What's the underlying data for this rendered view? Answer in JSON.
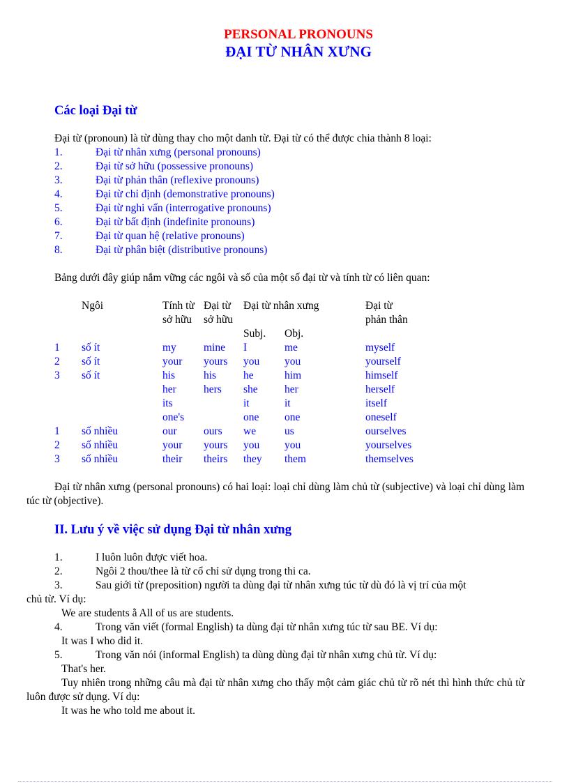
{
  "header": {
    "title_en": "PERSONAL PRONOUNS",
    "title_vn": "ĐẠI TỪ NHÂN XƯNG"
  },
  "section1": {
    "heading": "Các loại Đại từ",
    "intro": "Đại từ (pronoun) là từ dùng thay cho một danh từ. Đại từ có thể được chia thành 8 loại:",
    "types": [
      {
        "num": "1.",
        "label": "Đại từ nhân xưng (personal pronouns)"
      },
      {
        "num": "2.",
        "label": "Đại từ sở hữu (possessive pronouns)"
      },
      {
        "num": "3.",
        "label": "Đại từ phản thân (reflexive pronouns)"
      },
      {
        "num": "4.",
        "label": "Đại từ chỉ định (demonstrative pronouns)"
      },
      {
        "num": "5.",
        "label": "Đại từ nghi vấn (interrogative pronouns)"
      },
      {
        "num": "6.",
        "label": "Đại từ bất định (indefinite pronouns)"
      },
      {
        "num": "7.",
        "label": "Đại từ quan hệ (relative pronouns)"
      },
      {
        "num": "8.",
        "label": "Đại từ phân biệt (distributive pronouns)"
      }
    ],
    "table_intro": "Bảng dưới đây giúp nắm vững các ngôi và số của một số đại từ và tính từ có liên quan:",
    "table": {
      "headers": {
        "person": "Ngôi",
        "poss_adj_1": "Tính từ",
        "poss_adj_2": "sở hữu",
        "poss_pron_1": "Đại từ",
        "poss_pron_2": "sở hữu",
        "personal": "Đại từ nhân xưng",
        "subj": "Subj.",
        "obj": "Obj.",
        "reflexive_1": "Đại từ",
        "reflexive_2": "phản thân"
      },
      "rows": [
        {
          "person": "1",
          "number": "số ít",
          "poss_adj": "my",
          "poss_pron": "mine",
          "subj": "I",
          "obj": "me",
          "reflexive": "myself"
        },
        {
          "person": "2",
          "number": "số ít",
          "poss_adj": "your",
          "poss_pron": "yours",
          "subj": "you",
          "obj": "you",
          "reflexive": "yourself"
        },
        {
          "person": "3",
          "number": "số ít",
          "poss_adj": "his",
          "poss_pron": "his",
          "subj": "he",
          "obj": "him",
          "reflexive": "himself"
        },
        {
          "person": "",
          "number": "",
          "poss_adj": "her",
          "poss_pron": "hers",
          "subj": "she",
          "obj": "her",
          "reflexive": "herself"
        },
        {
          "person": "",
          "number": "",
          "poss_adj": "its",
          "poss_pron": "",
          "subj": "it",
          "obj": "it",
          "reflexive": "itself"
        },
        {
          "person": "",
          "number": "",
          "poss_adj": "one's",
          "poss_pron": "",
          "subj": "one",
          "obj": "one",
          "reflexive": "oneself"
        },
        {
          "person": "1",
          "number": "số nhiều",
          "poss_adj": "our",
          "poss_pron": "ours",
          "subj": "we",
          "obj": "us",
          "reflexive": "ourselves"
        },
        {
          "person": "2",
          "number": "số nhiều",
          "poss_adj": "your",
          "poss_pron": "yours",
          "subj": "you",
          "obj": "you",
          "reflexive": "yourselves"
        },
        {
          "person": "3",
          "number": "số nhiều",
          "poss_adj": "their",
          "poss_pron": "theirs",
          "subj": "they",
          "obj": "them",
          "reflexive": "themselves"
        }
      ]
    },
    "closing": "Đại từ nhân xưng (personal pronouns) có hai loại: loại chỉ dùng làm chủ từ (subjective) và loại chỉ dùng làm túc từ (objective)."
  },
  "section2": {
    "heading": "II. Lưu ý về việc sử dụng Đại từ nhân  xưng",
    "items": [
      {
        "num": "1.",
        "text": "I luôn luôn được viết hoa."
      },
      {
        "num": "2.",
        "text": "Ngôi 2 thou/thee là từ cổ chỉ sử dụng trong thi ca."
      },
      {
        "num": "3.",
        "text": "Sau giới từ (preposition) người ta dùng đại từ nhân xưng túc từ dù đó là vị trí của một",
        "cont": "chủ từ. Ví dụ:",
        "example": "We are students ằ All of us are students."
      },
      {
        "num": "4.",
        "text": "Trong văn viết (formal English) ta dùng đại từ nhân xưng túc từ sau BE. Ví dụ:",
        "example": "It was I who did it."
      },
      {
        "num": "5.",
        "text": "Trong văn nói (informal English) ta dùng dùng đại từ nhân xưng chủ từ. Ví dụ:",
        "example": "That's her."
      }
    ],
    "note": "Tuy nhiên trong những câu mà đại từ nhân xưng cho thấy một cảm giác chủ từ rõ nét thì hình thức chủ từ luôn được sử dụng.  Ví dụ:",
    "note_example": "It was he who told me about it."
  }
}
